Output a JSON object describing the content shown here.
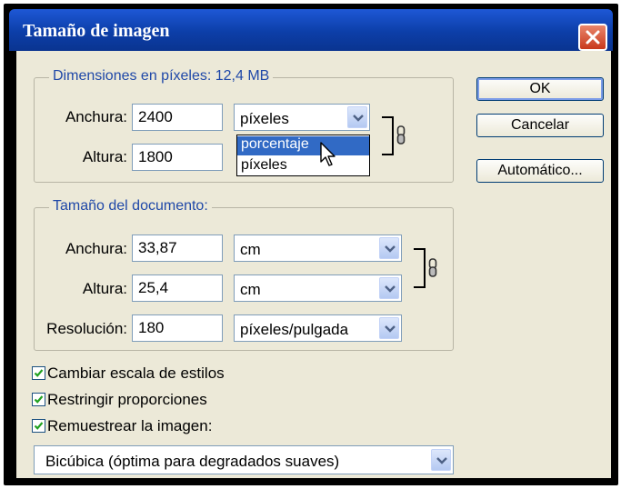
{
  "window": {
    "title": "Tamaño de imagen"
  },
  "pixel_dimensions": {
    "legend": "Dimensiones en píxeles: 12,4 MB",
    "width_label": "Anchura:",
    "width_value": "2400",
    "width_unit": "píxeles",
    "height_label": "Altura:",
    "height_value": "1800",
    "unit_options": [
      "porcentaje",
      "píxeles"
    ],
    "highlighted_option": "porcentaje"
  },
  "document_size": {
    "legend": "Tamaño del documento:",
    "width_label": "Anchura:",
    "width_value": "33,87",
    "width_unit": "cm",
    "height_label": "Altura:",
    "height_value": "25,4",
    "height_unit": "cm",
    "resolution_label": "Resolución:",
    "resolution_value": "180",
    "resolution_unit": "píxeles/pulgada"
  },
  "buttons": {
    "ok": "OK",
    "cancel": "Cancelar",
    "auto": "Automático..."
  },
  "options": {
    "scale_styles": {
      "label": "Cambiar escala de estilos",
      "checked": true
    },
    "constrain": {
      "label": "Restringir proporciones",
      "checked": true
    },
    "resample": {
      "label": "Remuestrear la imagen:",
      "checked": true
    },
    "resample_method": "Bicúbica (óptima para degradados suaves)"
  },
  "colors": {
    "title_bar": "#0c3ea8",
    "legend_text": "#1f48a8",
    "dialog_bg": "#ece9d8",
    "selection": "#316ac5",
    "close_button": "#d6452a"
  },
  "icons": [
    "close-icon",
    "dropdown-arrow-icon",
    "chain-link-icon",
    "checkmark-icon",
    "mouse-pointer-icon"
  ]
}
